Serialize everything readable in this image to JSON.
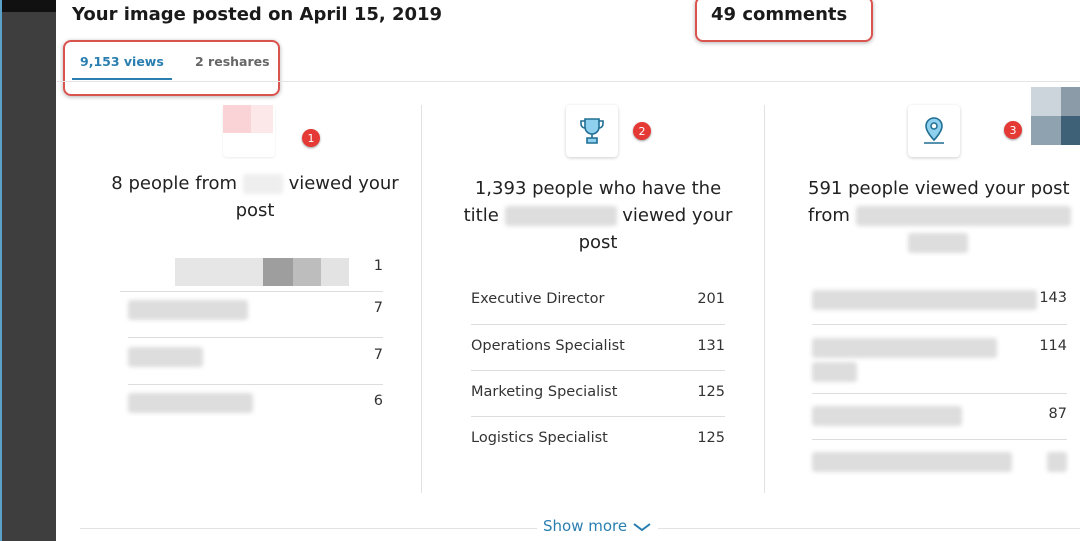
{
  "header": {
    "title": "Your image posted on April 15, 2019",
    "comments": "49 comments"
  },
  "tabs": [
    {
      "label": "9,153 views",
      "active": true
    },
    {
      "label": "2 reshares",
      "active": false
    }
  ],
  "colors": {
    "accent": "#2a7fb0",
    "annotation": "#d9534f",
    "badge": "#e53935"
  },
  "cards": [
    {
      "badge": "1",
      "icon": "company-logo-icon",
      "head_pre": "8 people from",
      "head_post": "viewed your post",
      "rows": [
        {
          "value": "1"
        },
        {
          "value": "7"
        },
        {
          "value": "7"
        },
        {
          "value": "6"
        }
      ]
    },
    {
      "badge": "2",
      "icon": "trophy-icon",
      "head_pre": "1,393 people who have the title",
      "head_post": "viewed your post",
      "rows": [
        {
          "label": "Executive Director",
          "value": "201"
        },
        {
          "label": "Operations Specialist",
          "value": "131"
        },
        {
          "label": "Marketing Specialist",
          "value": "125"
        },
        {
          "label": "Logistics Specialist",
          "value": "125"
        }
      ]
    },
    {
      "badge": "3",
      "icon": "location-pin-icon",
      "head_pre": "591 people viewed your post from",
      "rows": [
        {
          "value": "143"
        },
        {
          "value": "114"
        },
        {
          "value": "87"
        },
        {
          "value": ""
        }
      ]
    }
  ],
  "footer": {
    "show_more": "Show more"
  }
}
